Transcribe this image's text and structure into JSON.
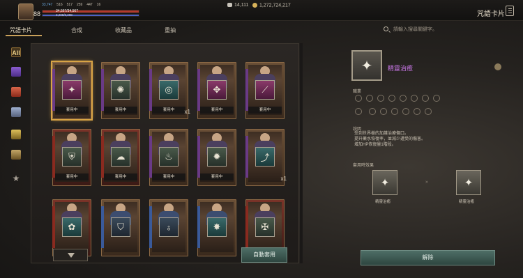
{
  "header": {
    "level": "88",
    "stat1": "33,747",
    "stat2": "516",
    "stat3": "517",
    "stat4": "259",
    "stat5": "447",
    "stat6": "16",
    "hp_text": "34,567/34,567",
    "mp_text": "3,208/3,208",
    "currency1": "14,111",
    "currency2": "1,272,724,217",
    "window_title": "咒語卡片"
  },
  "tabs": [
    "咒語卡片",
    "合成",
    "收藏品",
    "重抽"
  ],
  "search": {
    "placeholder": "請輸入搜尋關鍵字。"
  },
  "sidebar": {
    "all_label": "All"
  },
  "cards": [
    {
      "tag": "套用中",
      "icon": "✦",
      "style": "v",
      "variant": "",
      "count": "",
      "selected": true
    },
    {
      "tag": "套用中",
      "icon": "✺",
      "style": "g",
      "variant": "",
      "count": "",
      "selected": false
    },
    {
      "tag": "套用中",
      "icon": "◎",
      "style": "c",
      "variant": "",
      "count": "x1",
      "selected": false
    },
    {
      "tag": "套用中",
      "icon": "✥",
      "style": "v",
      "variant": "",
      "count": "",
      "selected": false
    },
    {
      "tag": "套用中",
      "icon": "⟋",
      "style": "v",
      "variant": "",
      "count": "",
      "selected": false
    },
    {
      "tag": "套用中",
      "icon": "⛨",
      "style": "g",
      "variant": "red",
      "count": "",
      "selected": false
    },
    {
      "tag": "套用中",
      "icon": "☁",
      "style": "g",
      "variant": "red",
      "count": "",
      "selected": false
    },
    {
      "tag": "套用中",
      "icon": "♨",
      "style": "g",
      "variant": "",
      "count": "",
      "selected": false
    },
    {
      "tag": "套用中",
      "icon": "✹",
      "style": "g",
      "variant": "",
      "count": "",
      "selected": false
    },
    {
      "tag": "",
      "icon": "⤴",
      "style": "c",
      "variant": "",
      "count": "x1",
      "selected": false
    },
    {
      "tag": "",
      "icon": "✿",
      "style": "c",
      "variant": "red",
      "count": "",
      "selected": false
    },
    {
      "tag": "",
      "icon": "⛉",
      "style": "k",
      "variant": "blue",
      "count": "",
      "selected": false
    },
    {
      "tag": "",
      "icon": "♁",
      "style": "k",
      "variant": "blue",
      "count": "",
      "selected": false
    },
    {
      "tag": "",
      "icon": "✸",
      "style": "c",
      "variant": "blue",
      "count": "",
      "selected": false
    },
    {
      "tag": "",
      "icon": "✠",
      "style": "g",
      "variant": "red",
      "count": "",
      "selected": false
    }
  ],
  "buttons": {
    "auto_apply": "自動套用",
    "unequip": "解除"
  },
  "detail": {
    "icon": "✦",
    "name": "精靈治癒",
    "jobs_label": "職業",
    "desc_label": "說明",
    "description": "受到世界樹的加護治療傷口。\n提升藥水恢復率，並減少遭受的傷害。\n增加HP恢復量1階段。",
    "growth_label": "套用時效果",
    "growth_from_label": "精靈治癒",
    "growth_to_label": "精靈治癒",
    "arrows": "»"
  }
}
